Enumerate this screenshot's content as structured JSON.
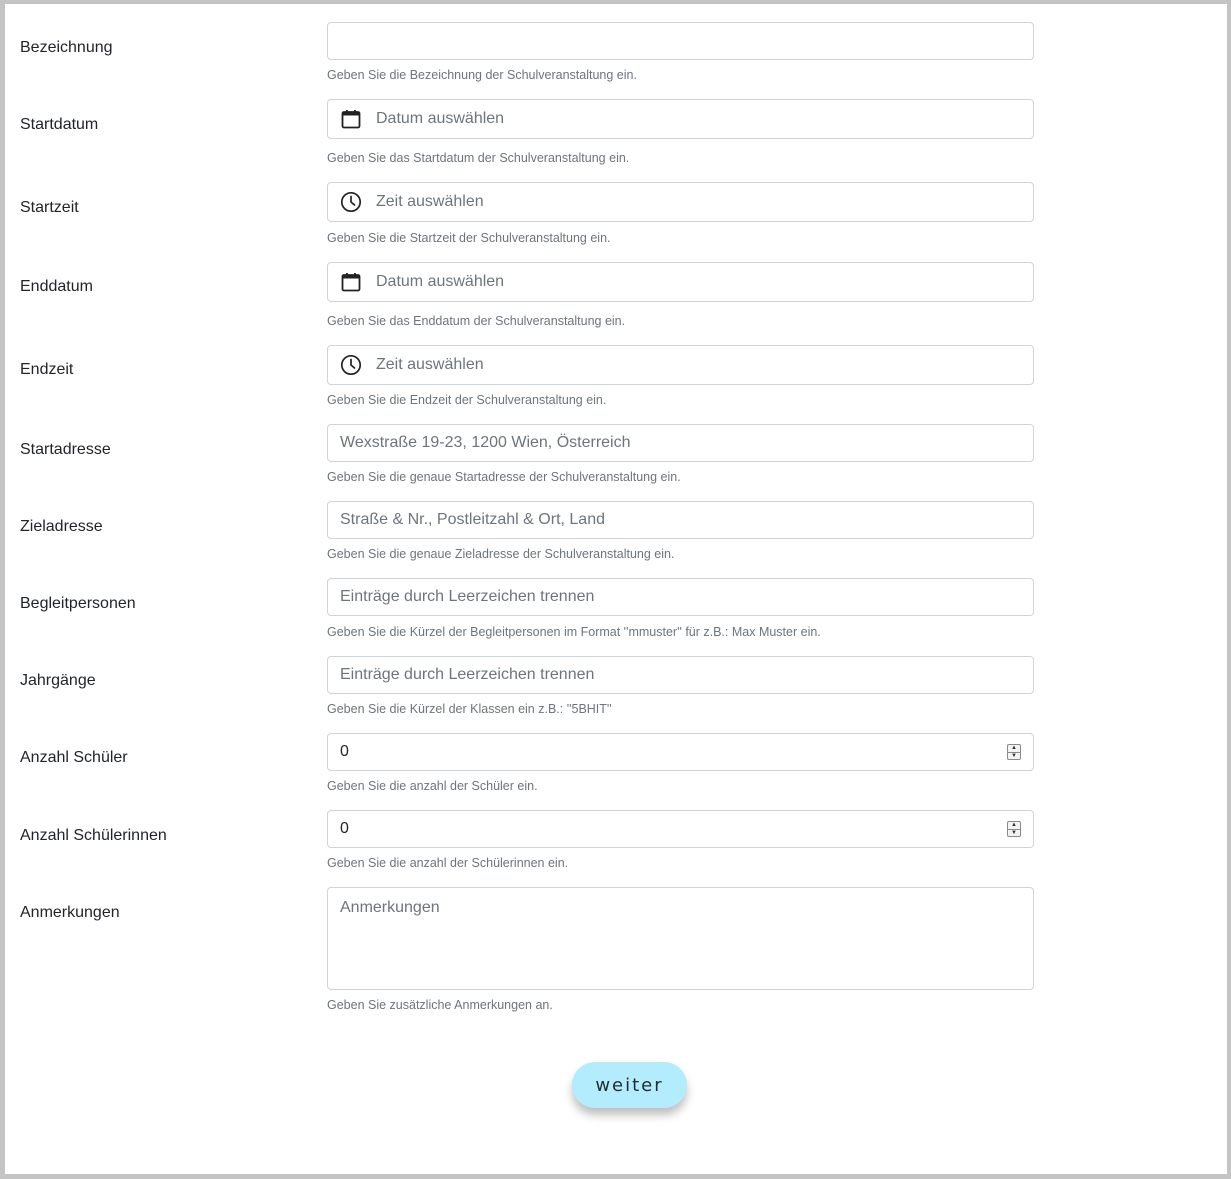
{
  "form": {
    "fields": [
      {
        "label": "Bezeichnung",
        "value": "",
        "placeholder": "",
        "help": "Geben Sie die Bezeichnung der Schulveranstaltung ein.",
        "icon": ""
      },
      {
        "label": "Startdatum",
        "value": "",
        "placeholder": "Datum auswählen",
        "help": "Geben Sie das Startdatum der Schulveranstaltung ein.",
        "icon": "calendar-icon"
      },
      {
        "label": "Startzeit",
        "value": "",
        "placeholder": "Zeit auswählen",
        "help": "Geben Sie die Startzeit der Schulveranstaltung ein.",
        "icon": "clock-icon"
      },
      {
        "label": "Enddatum",
        "value": "",
        "placeholder": "Datum auswählen",
        "help": "Geben Sie das Enddatum der Schulveranstaltung ein.",
        "icon": "calendar-icon"
      },
      {
        "label": "Endzeit",
        "value": "",
        "placeholder": "Zeit auswählen",
        "help": "Geben Sie die Endzeit der Schulveranstaltung ein.",
        "icon": "clock-icon"
      },
      {
        "label": "Startadresse",
        "value": "",
        "placeholder": "Wexstraße 19-23, 1200 Wien, Österreich",
        "help": "Geben Sie die genaue Startadresse der Schulveranstaltung ein.",
        "icon": ""
      },
      {
        "label": "Zieladresse",
        "value": "",
        "placeholder": "Straße & Nr., Postleitzahl & Ort, Land",
        "help": "Geben Sie die genaue Zieladresse der Schulveranstaltung ein.",
        "icon": ""
      },
      {
        "label": "Begleitpersonen",
        "value": "",
        "placeholder": "Einträge durch Leerzeichen trennen",
        "help": "Geben Sie die Kürzel der Begleitpersonen im Format ''mmuster'' für z.B.: Max Muster ein.",
        "icon": ""
      },
      {
        "label": "Jahrgänge",
        "value": "",
        "placeholder": "Einträge durch Leerzeichen trennen",
        "help": "Geben Sie die Kürzel der Klassen ein z.B.: ''5BHIT''",
        "icon": ""
      },
      {
        "label": "Anzahl Schüler",
        "value": "0",
        "placeholder": "",
        "help": "Geben Sie die anzahl der Schüler ein.",
        "icon": ""
      },
      {
        "label": "Anzahl Schülerinnen",
        "value": "0",
        "placeholder": "",
        "help": "Geben Sie die anzahl der Schülerinnen ein.",
        "icon": ""
      },
      {
        "label": "Anmerkungen",
        "value": "",
        "placeholder": "Anmerkungen",
        "help": "Geben Sie zusätzliche Anmerkungen an.",
        "icon": ""
      }
    ]
  },
  "submit_label": "weiter"
}
